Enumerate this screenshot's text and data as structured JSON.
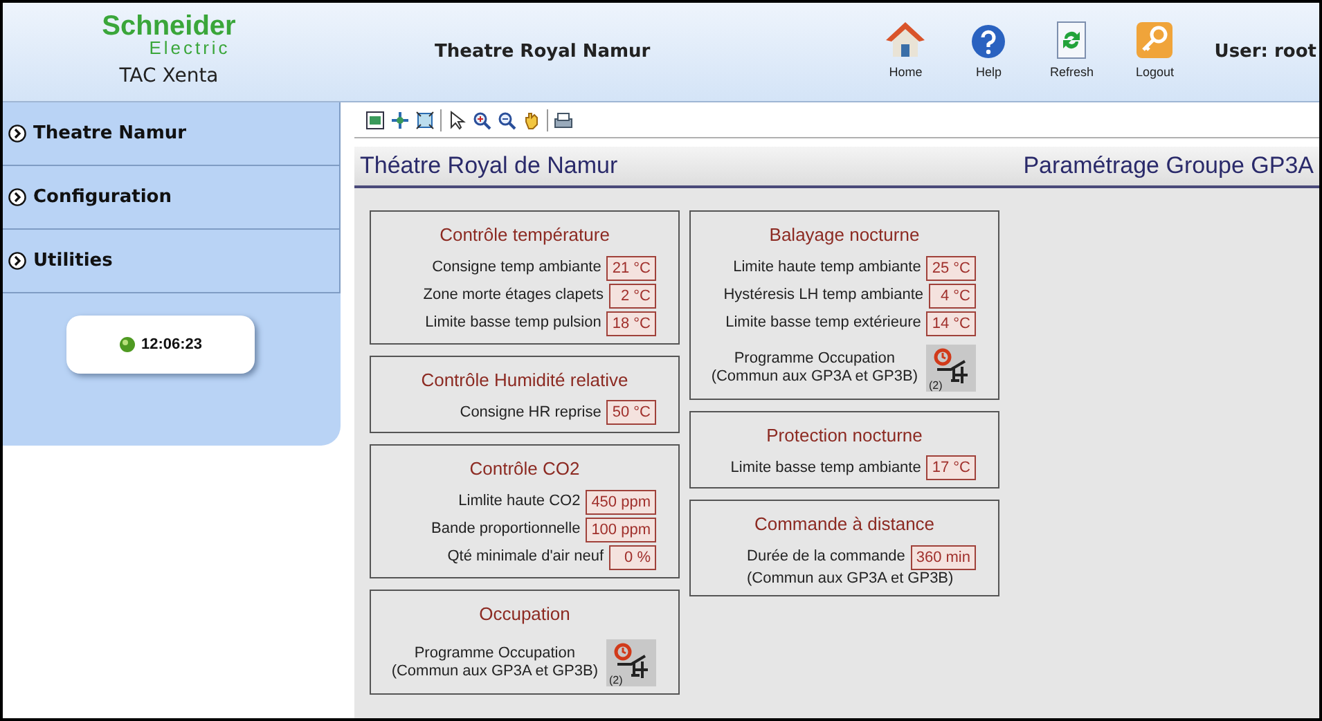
{
  "header": {
    "logo_line1": "Schneider",
    "logo_line2": "Electric",
    "product": "TAC Xenta",
    "site": "Theatre Royal Namur",
    "user": "User: root"
  },
  "nav_buttons": [
    {
      "kind": "home",
      "label": "Home"
    },
    {
      "kind": "help",
      "label": "Help"
    },
    {
      "kind": "refresh",
      "label": "Refresh"
    },
    {
      "kind": "logout",
      "label": "Logout"
    }
  ],
  "sidebar": {
    "items": [
      {
        "label": "Theatre Namur"
      },
      {
        "label": "Configuration"
      },
      {
        "label": "Utilities"
      }
    ],
    "clock": "12:06:23"
  },
  "page": {
    "title": "Théatre Royal de Namur",
    "subtitle": "Paramétrage Groupe GP3A"
  },
  "columns": [
    [
      {
        "title": "Contrôle température",
        "rows": [
          {
            "kind": "param",
            "label": "Consigne temp ambiante",
            "value": "21 °C"
          },
          {
            "kind": "param",
            "label": "Zone morte étages clapets",
            "value": "2 °C"
          },
          {
            "kind": "param",
            "label": "Limite basse temp pulsion",
            "value": "18 °C"
          }
        ]
      },
      {
        "title": "Contrôle Humidité relative",
        "rows": [
          {
            "kind": "param",
            "label": "Consigne HR reprise",
            "value": "50 °C"
          }
        ]
      },
      {
        "title": "Contrôle CO2",
        "rows": [
          {
            "kind": "param",
            "label": "Limlite haute CO2",
            "value": "450 ppm"
          },
          {
            "kind": "param",
            "label": "Bande proportionnelle",
            "value": "100 ppm"
          },
          {
            "kind": "param",
            "label": "Qté minimale d'air neuf",
            "value": "0 %"
          }
        ]
      },
      {
        "title": "Occupation",
        "rows": [
          {
            "kind": "program",
            "label": "Programme Occupation",
            "note": "(Commun aux GP3A et GP3B)",
            "badge": "(2)"
          }
        ]
      }
    ],
    [
      {
        "title": "Balayage nocturne",
        "rows": [
          {
            "kind": "param",
            "label": "Limite haute temp ambiante",
            "value": "25 °C"
          },
          {
            "kind": "param",
            "label": "Hystéresis LH temp ambiante",
            "value": "4 °C"
          },
          {
            "kind": "param",
            "label": "Limite basse temp extérieure",
            "value": "14 °C"
          },
          {
            "kind": "program",
            "label": "Programme Occupation",
            "note": "(Commun aux GP3A et GP3B)",
            "badge": "(2)"
          }
        ]
      },
      {
        "title": "Protection nocturne",
        "rows": [
          {
            "kind": "param",
            "label": "Limite basse temp ambiante",
            "value": "17 °C"
          }
        ]
      },
      {
        "title": "Commande à distance",
        "rows": [
          {
            "kind": "param",
            "label": "Durée de la commande",
            "value": "360 min",
            "note": "(Commun aux GP3A et GP3B)"
          }
        ]
      }
    ]
  ]
}
